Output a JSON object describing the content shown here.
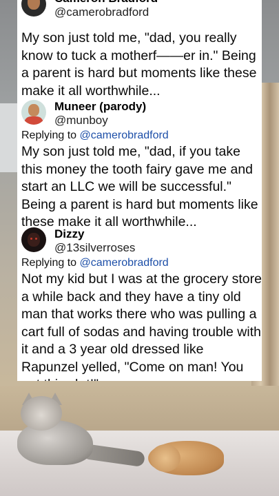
{
  "tweets": [
    {
      "display_name": "Cameron Bradford",
      "handle": "@camerobradford",
      "text": "My son just told me, \"dad, you really know to tuck a motherf——er in.\" Being a parent is hard but moments like these make it all worthwhile..."
    },
    {
      "display_name": "Muneer (parody)",
      "handle": "@munboy",
      "replying_to_prefix": "Replying to",
      "replying_to_handle": "@camerobradford",
      "text": "My son just told me, \"dad, if you take this money the tooth fairy gave me and start an LLC we will be successful.\" Being a parent is hard but moments like these make it all worthwhile..."
    },
    {
      "display_name": "Dizzy",
      "handle": "@13silverroses",
      "replying_to_prefix": "Replying to",
      "replying_to_handle": "@camerobradford",
      "text": "Not my kid but I was at the grocery store a while back and they have a tiny old man that works there who was pulling a cart full of sodas and having trouble with it and a 3 year old dressed like Rapunzel yelled, \"Come on man! You got this sh t!\""
    }
  ],
  "colors": {
    "card_background": "#ffffff",
    "mention": "#1d4fa8",
    "text": "#0a0a0a"
  },
  "icons": {
    "avatar_1": "avatar-cameron",
    "avatar_2": "avatar-munboy",
    "avatar_3": "avatar-dizzy"
  }
}
